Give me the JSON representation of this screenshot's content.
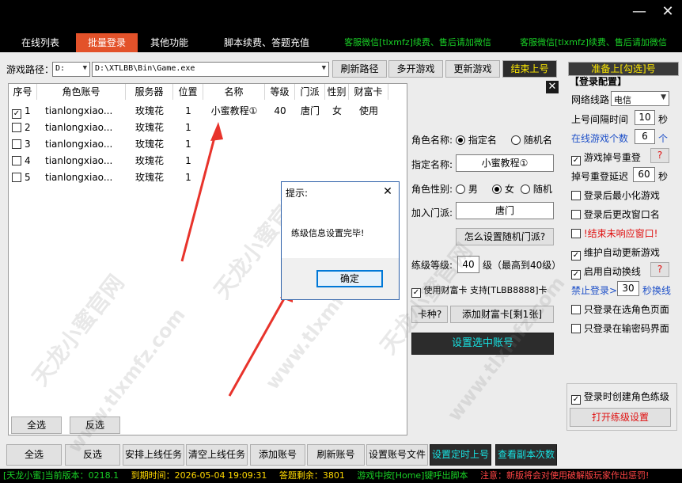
{
  "window": {
    "minimize_glyph": "—",
    "close_glyph": "✕"
  },
  "tabs": [
    {
      "label": "在线列表"
    },
    {
      "label": "批量登录"
    },
    {
      "label": "其他功能"
    },
    {
      "label": "脚本续费、答题充值"
    },
    {
      "label": "客服微信[tlxmfz]续费、售后请加微信"
    },
    {
      "label": "客服微信[tlxmfz]续费、售后请加微信"
    }
  ],
  "toolbar": {
    "path_label": "游戏路径：",
    "drive_value": "D:",
    "path_value": "D:\\XTLBB\\Bin\\Game.exe",
    "refresh_path": "刷新路径",
    "multi_open": "多开游戏",
    "update_game": "更新游戏",
    "end_online": "结束上号",
    "ready_online": "准备上[勾选]号"
  },
  "table": {
    "headers": [
      "序号",
      "角色账号",
      "服务器",
      "位置",
      "名称",
      "等级",
      "门派",
      "性别",
      "财富卡"
    ],
    "rows": [
      {
        "no": "1",
        "checked": "✓",
        "account": "tianlongxiao...",
        "server": "玫瑰花",
        "pos": "1",
        "name": "小蜜教程①",
        "level": "40",
        "sect": "唐门",
        "gender": "女",
        "card": "使用"
      },
      {
        "no": "2",
        "checked": "",
        "account": "tianlongxiao...",
        "server": "玫瑰花",
        "pos": "1",
        "name": "",
        "level": "",
        "sect": "",
        "gender": "",
        "card": ""
      },
      {
        "no": "3",
        "checked": "",
        "account": "tianlongxiao...",
        "server": "玫瑰花",
        "pos": "1",
        "name": "",
        "level": "",
        "sect": "",
        "gender": "",
        "card": ""
      },
      {
        "no": "4",
        "checked": "",
        "account": "tianlongxiao...",
        "server": "玫瑰花",
        "pos": "1",
        "name": "",
        "level": "",
        "sect": "",
        "gender": "",
        "card": ""
      },
      {
        "no": "5",
        "checked": "",
        "account": "tianlongxiao...",
        "server": "玫瑰花",
        "pos": "1",
        "name": "",
        "level": "",
        "sect": "",
        "gender": "",
        "card": ""
      }
    ]
  },
  "middle": {
    "role_name_label": "角色名称:",
    "opt_specified": "指定名",
    "opt_random": "随机名",
    "specified_name_label": "指定名称:",
    "specified_name_value": "小蜜教程①",
    "gender_label": "角色性别:",
    "gender_male": "男",
    "gender_female": "女",
    "gender_random": "随机",
    "join_sect_label": "加入门派:",
    "join_sect_value": "唐门",
    "how_random_sect": "怎么设置随机门派?",
    "level_label": "练级等级:",
    "level_value": "40",
    "level_suffix": "级（最高到40级）",
    "use_card_label": "使用财富卡  支持[TLBB8888]卡",
    "card_type": "卡种?",
    "add_card": "添加财富卡[剩1张]",
    "set_selected": "设置选中账号"
  },
  "config": {
    "title": "【登录配置】",
    "network_label": "网络线路",
    "network_value": "电信",
    "interval_label": "上号间隔时间",
    "interval_value": "10",
    "interval_unit": "秒",
    "online_count_label": "在线游戏个数",
    "online_count_value": "6",
    "online_count_unit": "个",
    "game_drop_relogin": "游戏掉号重登",
    "help_mark": "?",
    "relogin_delay_label": "掉号重登延迟",
    "relogin_delay_value": "60",
    "relogin_delay_unit": "秒",
    "min_after_login": "登录后最小化游戏",
    "rename_after_login": "登录后更改窗口名",
    "end_unresponsive": "!结束未响应窗口!",
    "maintain_update": "维护自动更新游戏",
    "auto_switch_line": "启用自动换线",
    "forbid_login_label": "禁止登录>",
    "forbid_login_value": "30",
    "forbid_login_suffix": "秒换线",
    "only_role_page": "只登录在选角色页面",
    "only_password_page": "只登录在输密码界面",
    "create_role_label": "登录时创建角色练级",
    "open_level_settings": "打开练级设置"
  },
  "left_bottom": {
    "select_all": "全选",
    "invert": "反选"
  },
  "bottom_bar": [
    "全选",
    "反选",
    "安排上线任务",
    "清空上线任务",
    "添加账号",
    "刷新账号",
    "设置账号文件",
    "设置定时上号",
    "查看副本次数"
  ],
  "dialog": {
    "title": "提示:",
    "message": "练级信息设置完毕!",
    "ok": "确定",
    "close_glyph": "✕"
  },
  "status": {
    "version": "[天龙小蜜]当前版本：0218.1",
    "expire": "到期时间：2026-05-04 19:09:31",
    "answers_left": "答题剩余：3801",
    "hint": "游戏中按[Home]键呼出脚本",
    "notice": "注意：新版将会对使用破解版玩家作出惩罚!"
  },
  "watermarks": [
    "天龙小蜜官网",
    "www.tlxmfz.com",
    "天龙小蜜官网",
    "www.tlxmfz.com",
    "天龙小蜜官网",
    "www.tlxmfz.com"
  ],
  "colors": {
    "active_tab": "#e3522a",
    "tab_green": "#19d126",
    "cyan_button_text": "#17e3e3",
    "yellow_button_text": "#ffea00",
    "arrow_red": "#e8332b",
    "status_green": "#19d126",
    "status_yellow": "#ffd900",
    "status_red": "#ff4545"
  }
}
